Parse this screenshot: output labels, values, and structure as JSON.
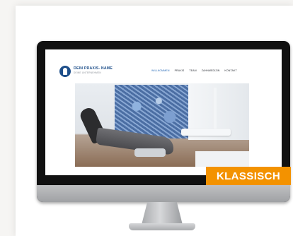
{
  "website": {
    "logo_name": "DEIN PRAXIS- NAME",
    "logo_sub": "DEINE UNTERNEHMEN",
    "nav": [
      "WILLKOMMEN",
      "PRAXIS",
      "TEAM",
      "ZAHNMEDIZIN",
      "KONTAKT"
    ],
    "active_nav": "WILLKOMMEN"
  },
  "badge": {
    "label": "KLASSISCH",
    "color": "#f39200"
  },
  "colors": {
    "brand": "#1e4f8a",
    "accent": "#f39200"
  },
  "icons": {
    "logo": "tooth-icon"
  }
}
